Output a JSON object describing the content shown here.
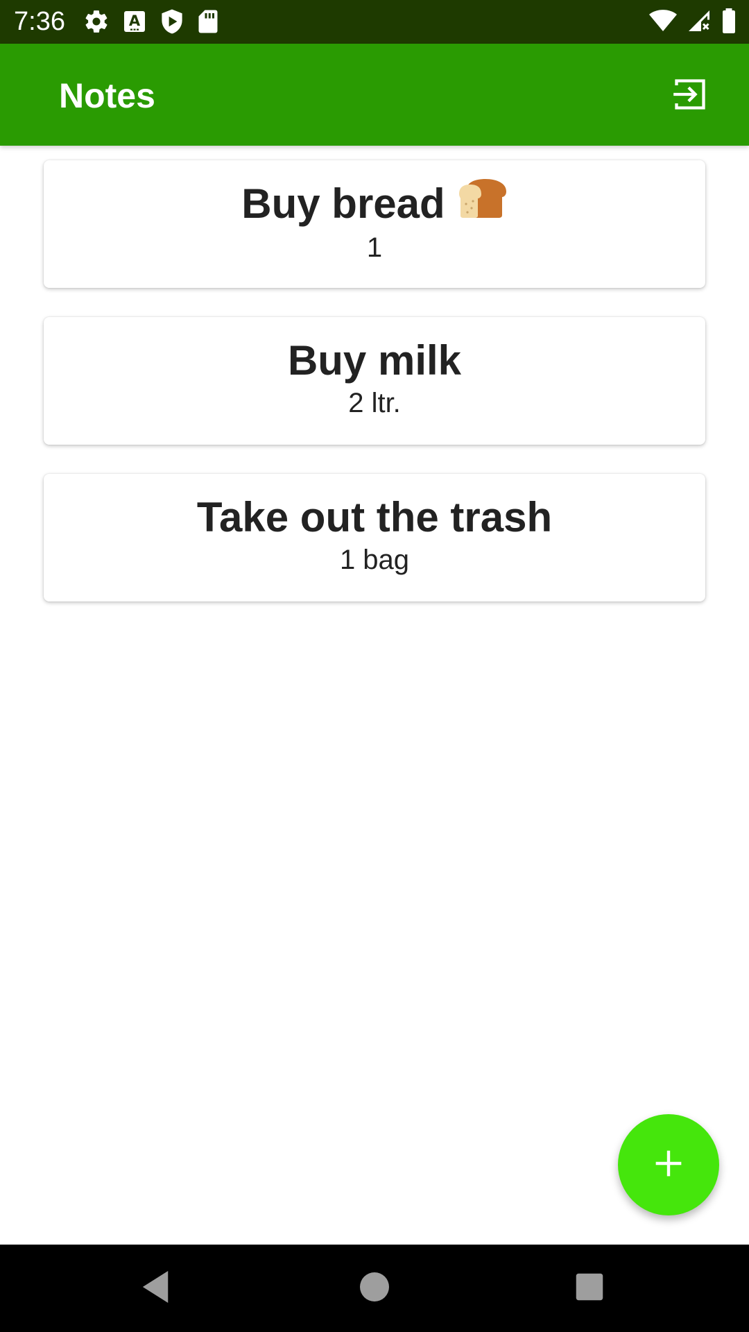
{
  "status_bar": {
    "time": "7:36",
    "left_icons": [
      "gear-icon",
      "a-badge-icon",
      "play-shield-icon",
      "sd-card-icon"
    ],
    "right_icons": [
      "wifi-icon",
      "signal-icon",
      "battery-icon"
    ]
  },
  "app_bar": {
    "title": "Notes",
    "action_icon": "logout-icon"
  },
  "notes": [
    {
      "title": "Buy bread",
      "emoji": "🍞",
      "subtitle": "1"
    },
    {
      "title": "Buy milk",
      "subtitle": "2 ltr."
    },
    {
      "title": "Take out the trash",
      "subtitle": "1 bag"
    }
  ],
  "fab": {
    "icon": "plus-icon"
  },
  "colors": {
    "status_bar": "#1e3a00",
    "app_bar": "#2a9b02",
    "fab": "#45e60c",
    "text": "#222222"
  },
  "nav_bar": {
    "buttons": [
      "back-icon",
      "home-icon",
      "recents-icon"
    ]
  }
}
